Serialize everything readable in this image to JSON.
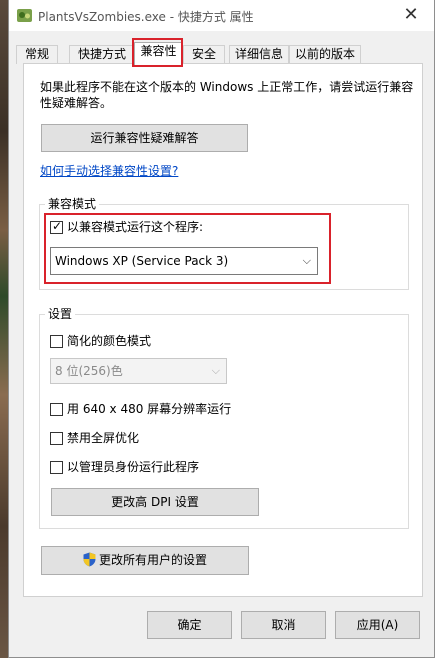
{
  "window": {
    "title": "PlantsVsZombies.exe - 快捷方式 属性",
    "close_glyph": "✕",
    "icon": "app-icon"
  },
  "tabs": [
    {
      "label": "常规"
    },
    {
      "label": "快捷方式"
    },
    {
      "label": "兼容性",
      "active": true
    },
    {
      "label": "安全"
    },
    {
      "label": "详细信息"
    },
    {
      "label": "以前的版本"
    }
  ],
  "panel": {
    "intro": "如果此程序不能在这个版本的 Windows 上正常工作，请尝试运行兼容性疑难解答。",
    "troubleshooter_button": "运行兼容性疑难解答",
    "manual_link": "如何手动选择兼容性设置?"
  },
  "compat_mode": {
    "group_label": "兼容模式",
    "checkbox_label": "以兼容模式运行这个程序:",
    "checked": true,
    "selected_os": "Windows XP (Service Pack 3)"
  },
  "settings": {
    "group_label": "设置",
    "reduced_color_label": "简化的颜色模式",
    "reduced_color_checked": false,
    "color_depth_selected": "8 位(256)色",
    "resolution_label": "用 640 x 480 屏幕分辨率运行",
    "fullscreen_opt_label": "禁用全屏优化",
    "admin_label": "以管理员身份运行此程序",
    "dpi_button": "更改高 DPI 设置"
  },
  "all_users_button": "更改所有用户的设置",
  "footer": {
    "ok": "确定",
    "cancel": "取消",
    "apply": "应用(A)"
  },
  "colors": {
    "highlight_red": "#d9222b",
    "link_blue": "#0047c6"
  },
  "icons": {
    "check": "✓",
    "dropdown": "⌵",
    "shield": "uac-shield-icon"
  }
}
